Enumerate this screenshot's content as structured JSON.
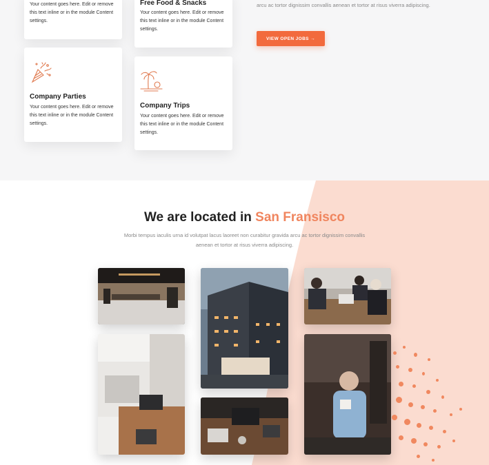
{
  "cards": {
    "left_top": {
      "body": "Your content goes here. Edit or remove this text inline or in the module Content settings."
    },
    "mid_top": {
      "title": "Free Food & Snacks",
      "body": "Your content goes here. Edit or remove this text inline or in the module Content settings."
    },
    "parties": {
      "title": "Company Parties",
      "body": "Your content goes here. Edit or remove this text inline or in the module Content settings.",
      "icon": "party-popper-icon"
    },
    "trips": {
      "title": "Company Trips",
      "body": "Your content goes here. Edit or remove this text inline or in the module Content settings.",
      "icon": "palm-tree-icon"
    }
  },
  "jobs": {
    "copy": "arcu ac tortor dignissim convallis aenean et tortor at risus viverra adipiscing.",
    "button_label": "VIEW OPEN JOBS →"
  },
  "location": {
    "heading_prefix": "We are located in",
    "heading_city": "San Fransisco",
    "subtitle": "Morbi tempus iaculis urna id volutpat lacus laoreet non curabitur gravida arcu ac tortor dignissim convallis aenean et tortor at risus viverra adipiscing."
  },
  "colors": {
    "accent": "#f26a3d",
    "accent_soft": "#fbd9cc",
    "heading_accent": "#f0855e"
  }
}
